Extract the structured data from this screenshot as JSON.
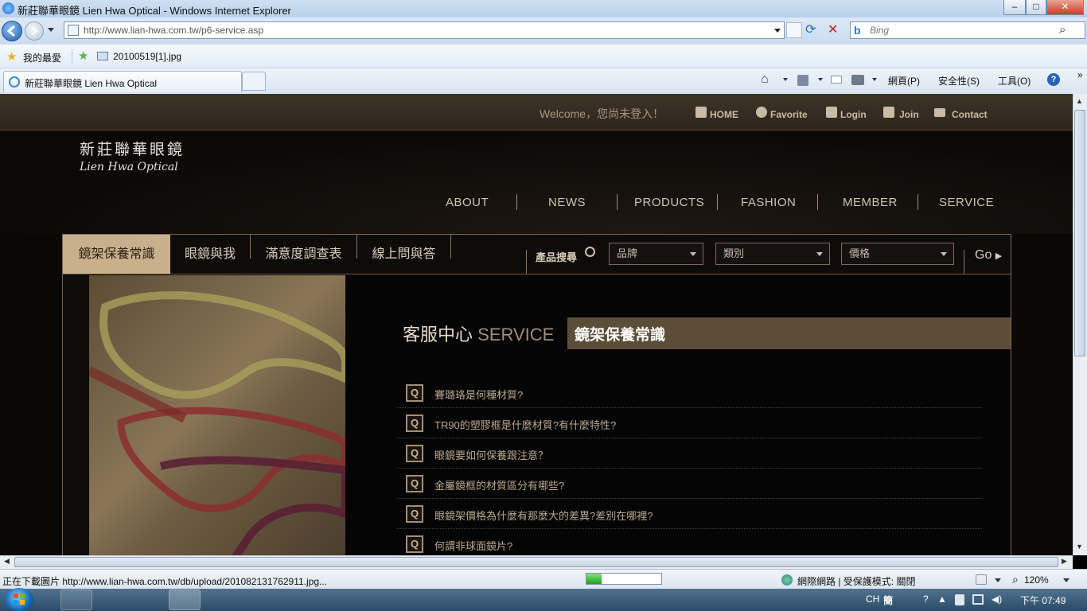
{
  "window": {
    "title": "新莊聯華眼鏡 Lien Hwa Optical - Windows Internet Explorer",
    "min": "–",
    "max": "□",
    "close": "✕"
  },
  "address": {
    "url": "http://www.lian-hwa.com.tw/p6-service.asp",
    "search_placeholder": "Bing"
  },
  "favorites": {
    "label": "我的最愛",
    "item": "20100519[1].jpg"
  },
  "tabs": [
    {
      "label": "新莊聯華眼鏡 Lien Hwa Optical"
    }
  ],
  "commandbar": {
    "page": "網頁(P)",
    "safety": "安全性(S)",
    "tools": "工具(O)",
    "more": "»"
  },
  "site": {
    "welcome": "Welcome，您尚未登入！",
    "toplinks": [
      "HOME",
      "Favorite",
      "Login",
      "Join",
      "Contact"
    ],
    "logo_cn": "新莊聯華眼鏡",
    "logo_en": "Lien Hwa Optical",
    "mainnav": [
      "ABOUT",
      "NEWS",
      "PRODUCTS",
      "FASHION",
      "MEMBER",
      "SERVICE"
    ],
    "subnav": [
      "鏡架保養常識",
      "眼鏡與我",
      "滿意度調查表",
      "線上問與答"
    ],
    "product_search": "產品搜尋",
    "selects": [
      "品牌",
      "類別",
      "價格"
    ],
    "go": "Go",
    "page_title_cn": "客服中心",
    "page_title_en": "SERVICE",
    "section_title": "鏡架保養常識",
    "q_icon": "Q",
    "questions": [
      "賽璐珞是何種材質?",
      "TR90的塑膠框是什麼材質?有什麼特性?",
      "眼鏡要如何保養跟注意？",
      "金屬鏡框的材質區分有哪些?",
      "眼鏡架價格為什麼有那麼大的差異?差別在哪裡?",
      "何謂非球面鏡片?"
    ]
  },
  "status": {
    "text": "正在下載圖片 http://www.lian-hwa.com.tw/db/upload/201082131762911.jpg...",
    "progress": 0.2,
    "zone": "網際網路 | 受保護模式: 關閉",
    "zoom": "120%"
  },
  "taskbar": {
    "lang": "CH",
    "ime": "簡",
    "time": "下午 07:49"
  },
  "colors": {
    "accent": "#c9b08c",
    "band": "#5c4d38",
    "text": "#b9a88d"
  }
}
